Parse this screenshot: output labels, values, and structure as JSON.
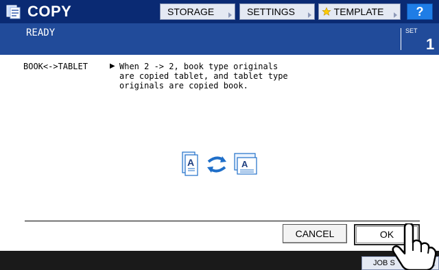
{
  "header": {
    "title": "COPY",
    "app_icon": "copy-icon",
    "buttons": [
      {
        "label": "STORAGE"
      },
      {
        "label": "SETTINGS"
      },
      {
        "label": "TEMPLATE",
        "icon": "star-icon"
      }
    ],
    "help_label": "?"
  },
  "status": {
    "text": "READY",
    "set_label": "SET",
    "set_count": "1"
  },
  "content": {
    "function_name": "BOOK<->TABLET",
    "arrow": "▶",
    "description": "When 2 -> 2,  book type originals\nare copied tablet, and tablet type\noriginals are copied book.",
    "illustration_letter": "A"
  },
  "actions": {
    "cancel_label": "CANCEL",
    "ok_label": "OK"
  },
  "footer": {
    "job_status_label": "JOB S"
  },
  "colors": {
    "title_bar": "#0a2a73",
    "status_bar": "#214b9a",
    "help_button": "#1f7de6",
    "star": "#ffcc00",
    "illustration_blue": "#1f6fc9"
  }
}
